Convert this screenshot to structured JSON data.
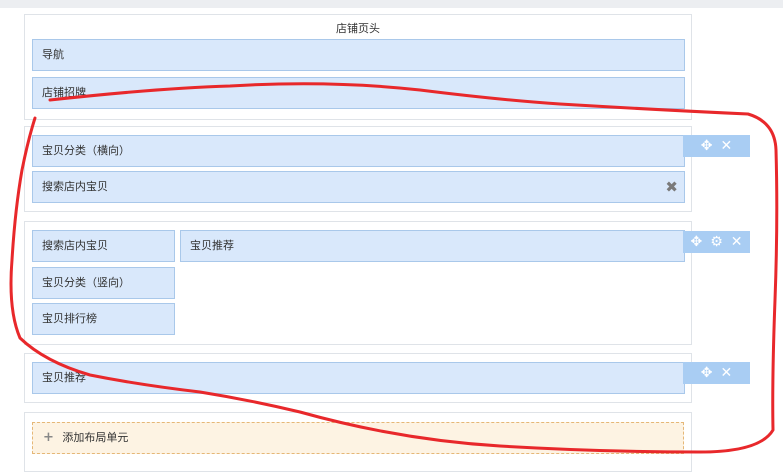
{
  "header_section": {
    "title": "店铺页头",
    "modules": [
      "导航",
      "店铺招牌"
    ]
  },
  "section2": {
    "modules": [
      "宝贝分类（横向）",
      "搜索店内宝贝"
    ],
    "remove_glyph": "✖"
  },
  "section3": {
    "left_modules": [
      "搜索店内宝贝",
      "宝贝分类（竖向）",
      "宝贝排行榜"
    ],
    "main_module": "宝贝推荐"
  },
  "section4": {
    "module": "宝贝推荐"
  },
  "add_unit": {
    "label": "添加布局单元"
  },
  "toolbar_icons": {
    "move": "✥",
    "settings": "⚙",
    "close": "✕"
  },
  "colors": {
    "module_bg": "#d9e8fb",
    "module_border": "#a9c8ea",
    "toolbar_bg": "#a9cdf3",
    "add_bg": "#fdf3e3",
    "add_border": "#e5b777",
    "annotation": "#e8282b"
  }
}
